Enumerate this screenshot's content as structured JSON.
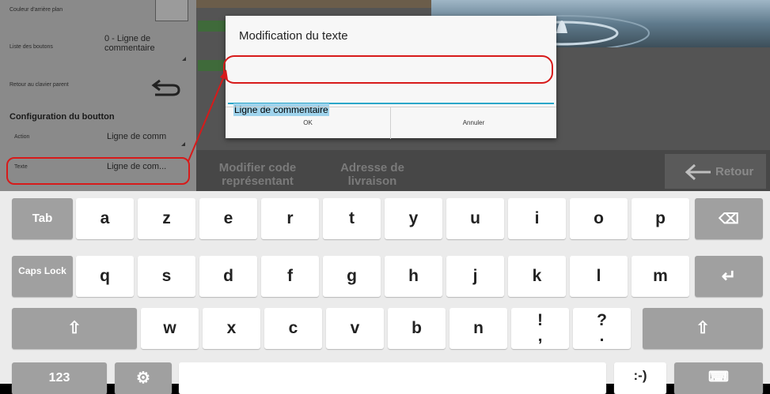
{
  "settings": {
    "background_color_label": "Couleur d'arrière plan",
    "button_list_label": "Liste des boutons",
    "button_list_value": "0 - Ligne de commentaire",
    "parent_keyboard_label": "Retour au clavier parent",
    "section_title": "Configuration du boutton",
    "action_label": "Action",
    "action_value": "Ligne de comm",
    "text_label": "Texte",
    "text_value": "Ligne de com..."
  },
  "toolbar": {
    "modify_rep_code": "Modifier code représentant",
    "delivery_address": "Adresse de livraison",
    "back": "Retour"
  },
  "dialog": {
    "title": "Modification du texte",
    "input_value": "Ligne de commentaire",
    "ok_label": "OK",
    "cancel_label": "Annuler"
  },
  "keyboard": {
    "row1": [
      "Tab",
      "a",
      "z",
      "e",
      "r",
      "t",
      "y",
      "u",
      "i",
      "o",
      "p",
      "⌫"
    ],
    "row2": [
      "Caps Lock",
      "q",
      "s",
      "d",
      "f",
      "g",
      "h",
      "j",
      "k",
      "l",
      "m",
      "↵"
    ],
    "row3": [
      "⇧",
      "w",
      "x",
      "c",
      "v",
      "b",
      "n",
      "!",
      ",",
      "?",
      ".",
      "⇧"
    ],
    "row4_left": "123",
    "row4_right": ":-)"
  },
  "colors": {
    "accent": "#2aa7c9",
    "annotation": "#d71a1a",
    "panel_bg": "#8a8a8a",
    "keyboard_bg": "#ebebeb"
  }
}
